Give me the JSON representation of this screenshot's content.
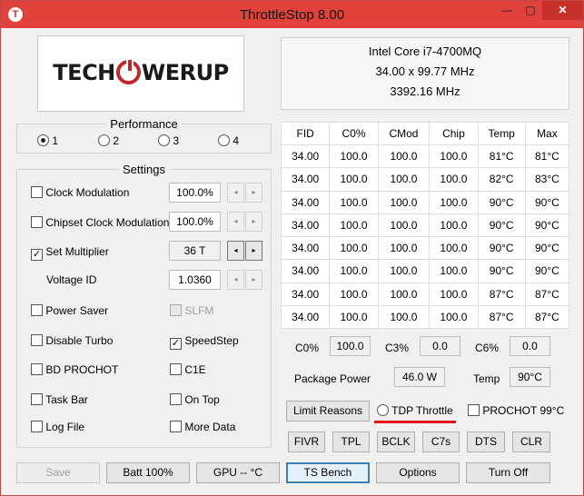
{
  "window": {
    "title": "ThrottleStop 8.00",
    "icon_letter": "T",
    "min_glyph": "—",
    "max_glyph": "▢",
    "close_glyph": "✕"
  },
  "logo": {
    "part1": "TECH",
    "part2": "WERUP"
  },
  "cpu": {
    "name": "Intel Core i7-4700MQ",
    "multiplier": "34.00 x 99.77 MHz",
    "frequency": "3392.16 MHz"
  },
  "performance": {
    "title": "Performance",
    "options": [
      "1",
      "2",
      "3",
      "4"
    ],
    "selected": "1"
  },
  "settings": {
    "title": "Settings",
    "clock_modulation": {
      "label": "Clock Modulation",
      "checked": false,
      "value": "100.0%"
    },
    "chipset_clock_modulation": {
      "label": "Chipset Clock Modulation",
      "checked": false,
      "value": "100.0%"
    },
    "set_multiplier": {
      "label": "Set Multiplier",
      "checked": true,
      "value": "36 T"
    },
    "voltage_id": {
      "label": "Voltage ID",
      "value": "1.0360"
    },
    "power_saver": {
      "label": "Power Saver",
      "checked": false
    },
    "slfm": {
      "label": "SLFM",
      "checked": false
    },
    "disable_turbo": {
      "label": "Disable Turbo",
      "checked": false
    },
    "speedstep": {
      "label": "SpeedStep",
      "checked": true
    },
    "bd_prochot": {
      "label": "BD PROCHOT",
      "checked": false
    },
    "c1e": {
      "label": "C1E",
      "checked": false
    },
    "task_bar": {
      "label": "Task Bar",
      "checked": false
    },
    "on_top": {
      "label": "On Top",
      "checked": false
    },
    "log_file": {
      "label": "Log File",
      "checked": false
    },
    "more_data": {
      "label": "More Data",
      "checked": false
    },
    "spin_left": "◂",
    "spin_right": "▸"
  },
  "table": {
    "headers": [
      "FID",
      "C0%",
      "CMod",
      "Chip",
      "Temp",
      "Max"
    ],
    "rows": [
      [
        "34.00",
        "100.0",
        "100.0",
        "100.0",
        "81°C",
        "81°C"
      ],
      [
        "34.00",
        "100.0",
        "100.0",
        "100.0",
        "82°C",
        "83°C"
      ],
      [
        "34.00",
        "100.0",
        "100.0",
        "100.0",
        "90°C",
        "90°C"
      ],
      [
        "34.00",
        "100.0",
        "100.0",
        "100.0",
        "90°C",
        "90°C"
      ],
      [
        "34.00",
        "100.0",
        "100.0",
        "100.0",
        "90°C",
        "90°C"
      ],
      [
        "34.00",
        "100.0",
        "100.0",
        "100.0",
        "90°C",
        "90°C"
      ],
      [
        "34.00",
        "100.0",
        "100.0",
        "100.0",
        "87°C",
        "87°C"
      ],
      [
        "34.00",
        "100.0",
        "100.0",
        "100.0",
        "87°C",
        "87°C"
      ]
    ]
  },
  "stats": {
    "c0_label": "C0%",
    "c0_value": "100.0",
    "c3_label": "C3%",
    "c3_value": "0.0",
    "c6_label": "C6%",
    "c6_value": "0.0",
    "package_power_label": "Package Power",
    "package_power_value": "46.0 W",
    "temp_label": "Temp",
    "temp_value": "90°C"
  },
  "limits": {
    "limit_reasons_label": "Limit Reasons",
    "tdp_throttle_label": "TDP Throttle",
    "prochot_label": "PROCHOT 99°C"
  },
  "tool_buttons": [
    "FIVR",
    "TPL",
    "BCLK",
    "C7s",
    "DTS",
    "CLR"
  ],
  "bottom_buttons": {
    "save": "Save",
    "batt": "Batt 100%",
    "gpu": "GPU -- °C",
    "ts_bench": "TS Bench",
    "options": "Options",
    "turn_off": "Turn Off"
  },
  "colors": {
    "title_bar": "#e0413a",
    "highlight_underline": "#e8141b",
    "logo_accent": "#c0262a"
  }
}
